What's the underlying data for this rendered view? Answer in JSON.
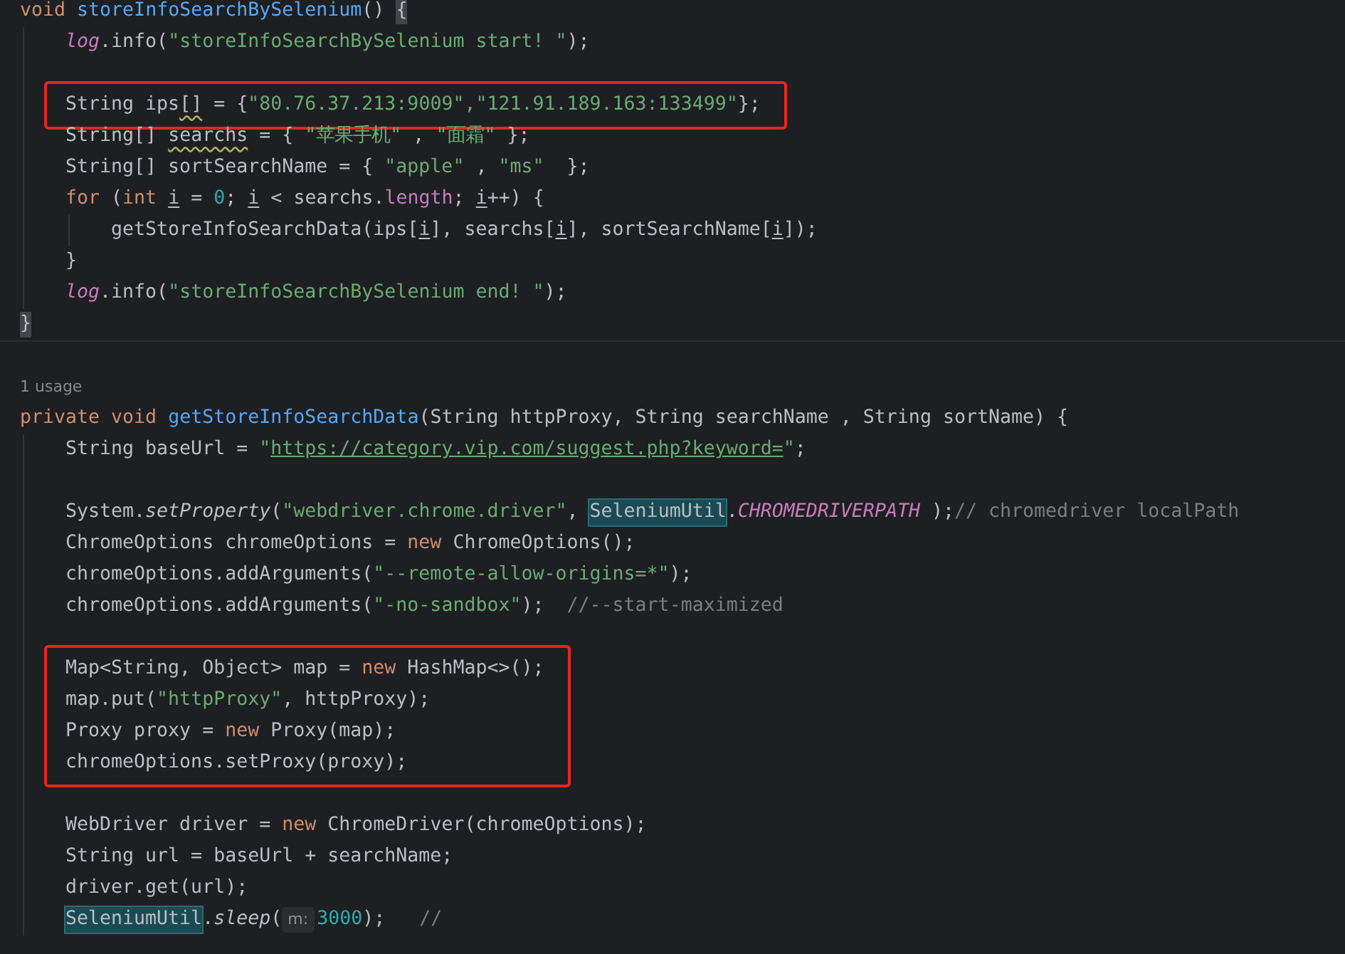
{
  "editor": {
    "items": [
      {
        "kind": "code",
        "tokens": [
          {
            "kind": "kw",
            "text": "void "
          },
          {
            "kind": "fn",
            "text": "storeInfoSearchBySelenium"
          },
          {
            "kind": "plain",
            "text": "() "
          },
          {
            "kind": "brace",
            "text": "{"
          }
        ]
      },
      {
        "kind": "block",
        "children": [
          {
            "kind": "code",
            "tokens": [
              {
                "kind": "static",
                "text": "log"
              },
              {
                "kind": "plain",
                "text": ".info("
              },
              {
                "kind": "str",
                "text": "\"storeInfoSearchBySelenium start! \""
              },
              {
                "kind": "plain",
                "text": ");"
              }
            ]
          },
          {
            "kind": "blank"
          },
          {
            "kind": "marked",
            "children": [
              {
                "kind": "code",
                "tokens": [
                  {
                    "kind": "plain",
                    "text": "String ips"
                  },
                  {
                    "kind": "warn",
                    "text": "[]"
                  },
                  {
                    "kind": "plain",
                    "text": " = {"
                  },
                  {
                    "kind": "str",
                    "text": "\"80.76.37.213:9009\",\"121.91.189.163:133499\""
                  },
                  {
                    "kind": "plain",
                    "text": "};"
                  }
                ]
              }
            ]
          },
          {
            "kind": "code",
            "tokens": [
              {
                "kind": "plain",
                "text": "String[] "
              },
              {
                "kind": "warn",
                "text": "searchs"
              },
              {
                "kind": "plain",
                "text": " = { "
              },
              {
                "kind": "str",
                "text": "\"苹果手机\""
              },
              {
                "kind": "plain",
                "text": " , "
              },
              {
                "kind": "str",
                "text": "\"面霜\""
              },
              {
                "kind": "plain",
                "text": " };"
              }
            ]
          },
          {
            "kind": "code",
            "tokens": [
              {
                "kind": "plain",
                "text": "String[] sortSearchName = { "
              },
              {
                "kind": "str",
                "text": "\"apple\""
              },
              {
                "kind": "plain",
                "text": " , "
              },
              {
                "kind": "str",
                "text": "\"ms\""
              },
              {
                "kind": "plain",
                "text": "  };"
              }
            ]
          },
          {
            "kind": "code",
            "tokens": [
              {
                "kind": "kw",
                "text": "for"
              },
              {
                "kind": "plain",
                "text": " ("
              },
              {
                "kind": "kw",
                "text": "int "
              },
              {
                "kind": "var",
                "text": "i"
              },
              {
                "kind": "plain",
                "text": " = "
              },
              {
                "kind": "num",
                "text": "0"
              },
              {
                "kind": "plain",
                "text": "; "
              },
              {
                "kind": "var",
                "text": "i"
              },
              {
                "kind": "plain",
                "text": " < searchs."
              },
              {
                "kind": "field",
                "text": "length"
              },
              {
                "kind": "plain",
                "text": "; "
              },
              {
                "kind": "var",
                "text": "i"
              },
              {
                "kind": "plain",
                "text": "++) {"
              }
            ]
          },
          {
            "kind": "block",
            "children": [
              {
                "kind": "code",
                "tokens": [
                  {
                    "kind": "plain",
                    "text": "getStoreInfoSearchData(ips["
                  },
                  {
                    "kind": "var",
                    "text": "i"
                  },
                  {
                    "kind": "plain",
                    "text": "], searchs["
                  },
                  {
                    "kind": "var",
                    "text": "i"
                  },
                  {
                    "kind": "plain",
                    "text": "], sortSearchName["
                  },
                  {
                    "kind": "var",
                    "text": "i"
                  },
                  {
                    "kind": "plain",
                    "text": "]);"
                  }
                ]
              }
            ]
          },
          {
            "kind": "code",
            "tokens": [
              {
                "kind": "plain",
                "text": "}"
              }
            ]
          },
          {
            "kind": "code",
            "tokens": [
              {
                "kind": "static",
                "text": "log"
              },
              {
                "kind": "plain",
                "text": ".info("
              },
              {
                "kind": "str",
                "text": "\"storeInfoSearchBySelenium end! \""
              },
              {
                "kind": "plain",
                "text": ");"
              }
            ]
          }
        ]
      },
      {
        "kind": "code",
        "tokens": [
          {
            "kind": "brace",
            "text": "}"
          }
        ]
      },
      {
        "kind": "separator"
      },
      {
        "kind": "usage",
        "text": "1 usage"
      },
      {
        "kind": "code",
        "tokens": [
          {
            "kind": "kw",
            "text": "private void "
          },
          {
            "kind": "fn",
            "text": "getStoreInfoSearchData"
          },
          {
            "kind": "plain",
            "text": "(String httpProxy, String searchName , String sortName) {"
          }
        ]
      },
      {
        "kind": "block",
        "children": [
          {
            "kind": "code",
            "tokens": [
              {
                "kind": "plain",
                "text": "String baseUrl = "
              },
              {
                "kind": "str",
                "text": "\""
              },
              {
                "kind": "link",
                "text": "https://category.vip.com/suggest.php?keyword="
              },
              {
                "kind": "str",
                "text": "\""
              },
              {
                "kind": "plain",
                "text": ";"
              }
            ]
          },
          {
            "kind": "blank"
          },
          {
            "kind": "code",
            "tokens": [
              {
                "kind": "plain",
                "text": "System."
              },
              {
                "kind": "method",
                "text": "setProperty"
              },
              {
                "kind": "plain",
                "text": "("
              },
              {
                "kind": "str",
                "text": "\"webdriver.chrome.driver\""
              },
              {
                "kind": "plain",
                "text": ", "
              },
              {
                "kind": "hl",
                "text": "SeleniumUtil"
              },
              {
                "kind": "plain",
                "text": "."
              },
              {
                "kind": "static",
                "text": "CHROMEDRIVERPATH"
              },
              {
                "kind": "plain",
                "text": " );"
              },
              {
                "kind": "comment",
                "text": "// chromedriver localPath"
              }
            ]
          },
          {
            "kind": "code",
            "tokens": [
              {
                "kind": "plain",
                "text": "ChromeOptions chromeOptions = "
              },
              {
                "kind": "kw",
                "text": "new"
              },
              {
                "kind": "plain",
                "text": " ChromeOptions();"
              }
            ]
          },
          {
            "kind": "code",
            "tokens": [
              {
                "kind": "plain",
                "text": "chromeOptions.addArguments("
              },
              {
                "kind": "str",
                "text": "\"--remote-allow-origins=*\""
              },
              {
                "kind": "plain",
                "text": ");"
              }
            ]
          },
          {
            "kind": "code",
            "tokens": [
              {
                "kind": "plain",
                "text": "chromeOptions.addArguments("
              },
              {
                "kind": "str",
                "text": "\"-no-sandbox\""
              },
              {
                "kind": "plain",
                "text": ");  "
              },
              {
                "kind": "comment",
                "text": "//--start-maximized"
              }
            ]
          },
          {
            "kind": "blank"
          },
          {
            "kind": "marked",
            "children": [
              {
                "kind": "code",
                "tokens": [
                  {
                    "kind": "plain",
                    "text": "Map<String, Object> map = "
                  },
                  {
                    "kind": "kw",
                    "text": "new"
                  },
                  {
                    "kind": "plain",
                    "text": " HashMap<>();"
                  }
                ]
              },
              {
                "kind": "code",
                "tokens": [
                  {
                    "kind": "plain",
                    "text": "map.put("
                  },
                  {
                    "kind": "str",
                    "text": "\"httpProxy\""
                  },
                  {
                    "kind": "plain",
                    "text": ", httpProxy);"
                  }
                ]
              },
              {
                "kind": "code",
                "tokens": [
                  {
                    "kind": "plain",
                    "text": "Proxy proxy = "
                  },
                  {
                    "kind": "kw",
                    "text": "new"
                  },
                  {
                    "kind": "plain",
                    "text": " Proxy(map);"
                  }
                ]
              },
              {
                "kind": "code",
                "tokens": [
                  {
                    "kind": "plain",
                    "text": "chromeOptions.setProxy(proxy);"
                  }
                ]
              }
            ]
          },
          {
            "kind": "blank"
          },
          {
            "kind": "code",
            "tokens": [
              {
                "kind": "plain",
                "text": "WebDriver driver = "
              },
              {
                "kind": "kw",
                "text": "new"
              },
              {
                "kind": "plain",
                "text": " ChromeDriver(chromeOptions);"
              }
            ]
          },
          {
            "kind": "code",
            "tokens": [
              {
                "kind": "plain",
                "text": "String url = baseUrl + searchName;"
              }
            ]
          },
          {
            "kind": "code",
            "tokens": [
              {
                "kind": "plain",
                "text": "driver.get(url);"
              }
            ]
          },
          {
            "kind": "code",
            "tokens": [
              {
                "kind": "hl",
                "text": "SeleniumUtil"
              },
              {
                "kind": "plain",
                "text": "."
              },
              {
                "kind": "method",
                "text": "sleep"
              },
              {
                "kind": "plain",
                "text": "("
              },
              {
                "kind": "hint",
                "text": "m:"
              },
              {
                "kind": "num",
                "text": "3000"
              },
              {
                "kind": "plain",
                "text": ");   "
              },
              {
                "kind": "comment",
                "text": "//"
              }
            ]
          }
        ]
      }
    ]
  }
}
